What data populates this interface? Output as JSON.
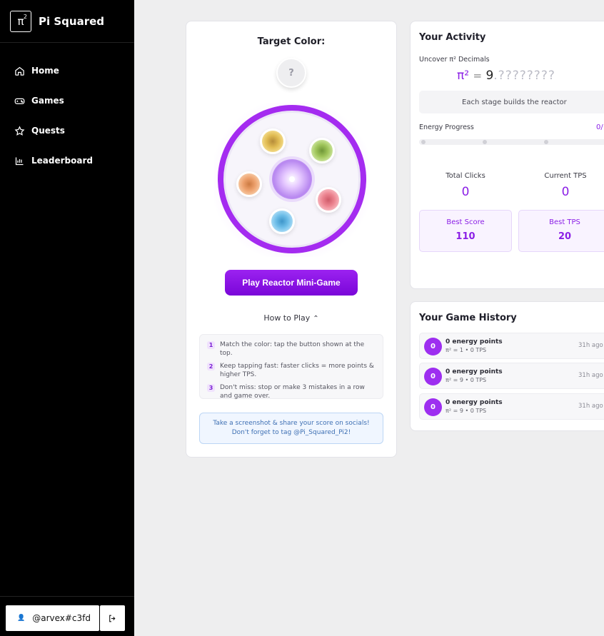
{
  "brand": {
    "logo_text": "π",
    "logo_sup": "2",
    "name": "Pi Squared"
  },
  "nav": [
    {
      "label": "Home",
      "icon": "home-icon"
    },
    {
      "label": "Games",
      "icon": "gamepad-icon"
    },
    {
      "label": "Quests",
      "icon": "star-icon"
    },
    {
      "label": "Leaderboard",
      "icon": "bar-chart-icon"
    }
  ],
  "user": {
    "handle": "@arvex#c3fd",
    "icon": "user-icon",
    "logout_icon": "logout-icon"
  },
  "game": {
    "target_title": "Target Color:",
    "target_value": "?",
    "play_label": "Play Reactor Mini-Game",
    "howto_label": "How to Play",
    "rules": [
      {
        "num": "1",
        "text": "Match the color: tap the button shown at the top."
      },
      {
        "num": "2",
        "text": "Keep tapping fast: faster clicks = more points & higher TPS."
      },
      {
        "num": "3",
        "text": "Don't miss: stop or make 3 mistakes in a row and game over."
      }
    ],
    "share_text": "Take a screenshot & share your score on socials! Don't forget to tag @Pi_Squared_Pi2!"
  },
  "activity": {
    "title": "Your Activity",
    "uncover_label": "Uncover π² Decimals",
    "pi_symbol": "π²",
    "equals": "=",
    "integer": "9",
    "decimals": ".????????",
    "stage_text": "Each stage builds the reactor",
    "energy_label": "Energy Progress",
    "energy_value": "0/",
    "total_clicks_label": "Total Clicks",
    "total_clicks": "0",
    "current_tps_label": "Current TPS",
    "current_tps": "0",
    "best_score_label": "Best Score",
    "best_score": "110",
    "best_tps_label": "Best TPS",
    "best_tps": "20"
  },
  "history": {
    "title": "Your Game History",
    "items": [
      {
        "badge": "0",
        "points": "0 energy points",
        "detail": "π² = 1 • 0 TPS",
        "ago": "31h ago"
      },
      {
        "badge": "0",
        "points": "0 energy points",
        "detail": "π² = 9 • 0 TPS",
        "ago": "31h ago"
      },
      {
        "badge": "0",
        "points": "0 energy points",
        "detail": "π² = 9 • 0 TPS",
        "ago": "31h ago"
      }
    ]
  },
  "colors": {
    "accent": "#8b1fe6",
    "reactor_ring": "#a42bf0",
    "sidebar_bg": "#000000",
    "page_bg": "#eeeeef"
  }
}
